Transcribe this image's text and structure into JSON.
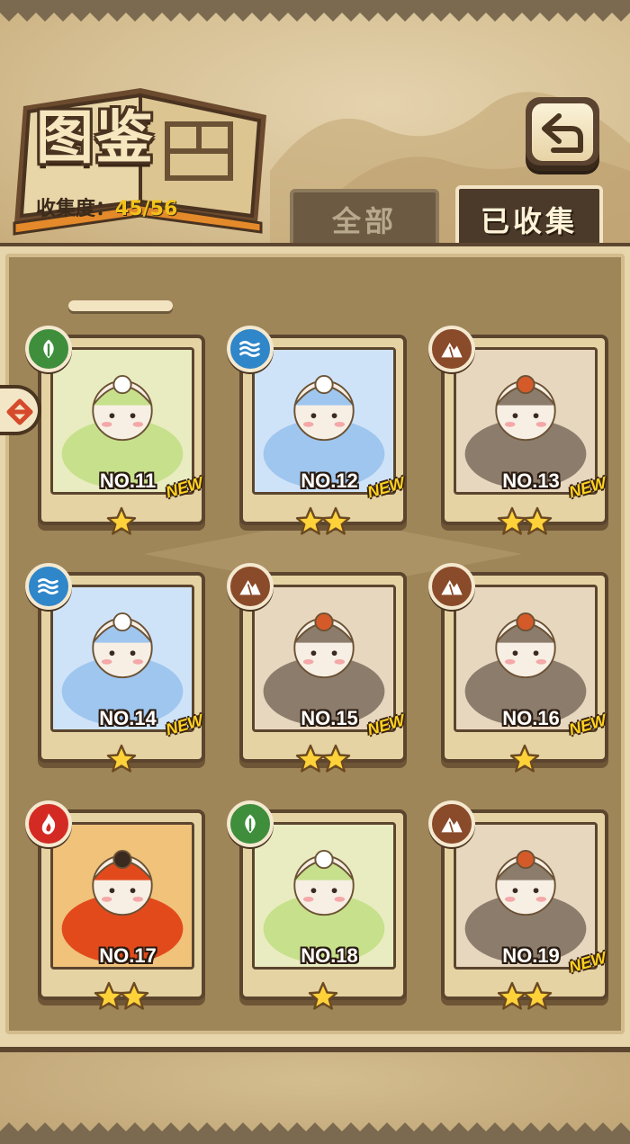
{
  "header": {
    "title": "图鉴",
    "collection_label": "收集度：",
    "collection_value": "45/56"
  },
  "tabs": [
    {
      "label": "全部",
      "active": false
    },
    {
      "label": "已收集",
      "active": true
    }
  ],
  "back_button": {
    "icon": "back-arrow-icon"
  },
  "cards": [
    {
      "number": "NO.11",
      "element": "leaf",
      "stars": 1,
      "is_new": true,
      "new_label": "NEW"
    },
    {
      "number": "NO.12",
      "element": "water",
      "stars": 2,
      "is_new": true,
      "new_label": "NEW"
    },
    {
      "number": "NO.13",
      "element": "earth",
      "stars": 2,
      "is_new": true,
      "new_label": "NEW"
    },
    {
      "number": "NO.14",
      "element": "water",
      "stars": 1,
      "is_new": true,
      "new_label": "NEW"
    },
    {
      "number": "NO.15",
      "element": "earth",
      "stars": 2,
      "is_new": true,
      "new_label": "NEW"
    },
    {
      "number": "NO.16",
      "element": "earth",
      "stars": 1,
      "is_new": true,
      "new_label": "NEW"
    },
    {
      "number": "NO.17",
      "element": "fire",
      "stars": 2,
      "is_new": false,
      "new_label": ""
    },
    {
      "number": "NO.18",
      "element": "leaf",
      "stars": 1,
      "is_new": false,
      "new_label": ""
    },
    {
      "number": "NO.19",
      "element": "earth",
      "stars": 2,
      "is_new": true,
      "new_label": "NEW"
    }
  ],
  "colors": {
    "accent_yellow": "#f2c21a",
    "leaf": "#3e8e3c",
    "water": "#2f86c9",
    "earth": "#8a4b2a",
    "fire": "#d32b24"
  }
}
